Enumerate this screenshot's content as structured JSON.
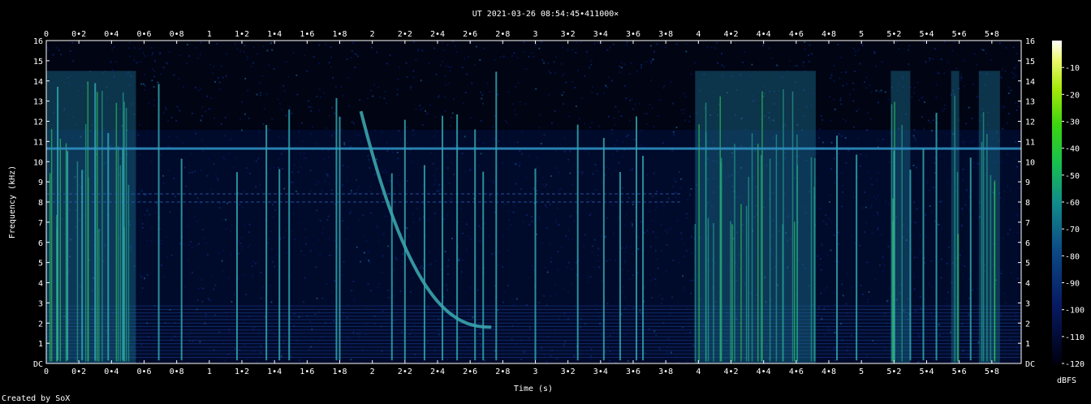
{
  "chart_data": {
    "type": "heatmap",
    "title": "UT 2021-03-26 08:54:45•411000×",
    "xlabel": "Time (s)",
    "ylabel": "Frequency (kHz)",
    "xlim": [
      0,
      5.98
    ],
    "ylim": [
      0,
      16
    ],
    "x_ticks": [
      "0",
      "0•2",
      "0•4",
      "0•6",
      "0•8",
      "1",
      "1•2",
      "1•4",
      "1•6",
      "1•8",
      "2",
      "2•2",
      "2•4",
      "2•6",
      "2•8",
      "3",
      "3•2",
      "3•4",
      "3•6",
      "3•8",
      "4",
      "4•2",
      "4•4",
      "4•6",
      "4•8",
      "5",
      "5•2",
      "5•4",
      "5•6",
      "5•8"
    ],
    "y_ticks": [
      "DC",
      "1",
      "2",
      "3",
      "4",
      "5",
      "6",
      "7",
      "8",
      "9",
      "10",
      "11",
      "12",
      "13",
      "14",
      "15",
      "16"
    ],
    "colorbar": {
      "label": "dBFS",
      "ticks": [
        "-10",
        "-20",
        "-30",
        "-40",
        "-50",
        "-60",
        "-70",
        "-80",
        "-90",
        "-100",
        "-110",
        "-120"
      ],
      "range": [
        -120,
        0
      ]
    },
    "features": {
      "hum_line_khz": 10.65,
      "dashed_lines_khz": [
        8.0,
        8.4
      ],
      "impulses_s": [
        0.07,
        0.13,
        0.22,
        0.3,
        0.38,
        0.47,
        0.69,
        0.83,
        1.17,
        1.35,
        1.43,
        1.49,
        1.78,
        1.8,
        2.12,
        2.2,
        2.32,
        2.43,
        2.52,
        2.63,
        2.68,
        2.76,
        3.0,
        3.26,
        3.42,
        3.52,
        3.62,
        3.66,
        4.85,
        4.97,
        5.2,
        5.3,
        5.38,
        5.46,
        5.67
      ],
      "dense_segments_s": [
        [
          0.0,
          0.55
        ],
        [
          3.98,
          4.72
        ],
        [
          5.18,
          5.3
        ],
        [
          5.55,
          5.6
        ],
        [
          5.72,
          5.85
        ]
      ],
      "whistler": {
        "t_start": 1.93,
        "t_end": 2.73,
        "f_start_khz": 12.5,
        "f_end_khz": 1.8
      }
    }
  },
  "footer": {
    "credit": "Created by SoX"
  }
}
